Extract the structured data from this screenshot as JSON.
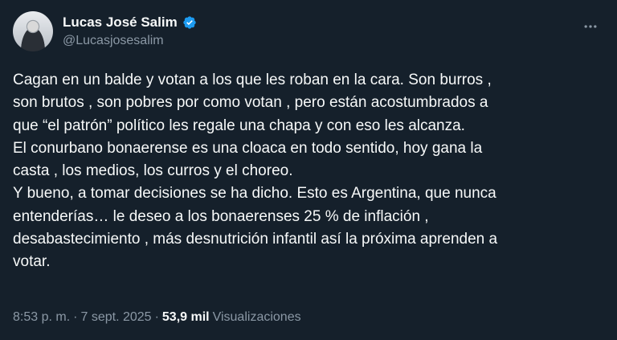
{
  "author": {
    "display_name": "Lucas José Salim",
    "handle": "@Lucasjosesalim",
    "verified": true,
    "avatar_icon": "profile-photo"
  },
  "more_icon": "more-horizontal-icon",
  "tweet": {
    "text": "Cagan en un balde y votan a los que les roban en la cara. Son burros ,\nson brutos , son pobres por como votan , pero están acostumbrados a\nque “el patrón” político les regale una chapa y con eso les alcanza.\nEl conurbano bonaerense es una cloaca en todo sentido, hoy gana la\ncasta , los medios, los curros y el choreo.\nY bueno, a tomar decisiones se ha dicho. Esto es Argentina, que nunca\nentenderías… le deseo a los bonaerenses 25 % de inflación ,\ndesabastecimiento , más desnutrición infantil así la próxima aprenden a\nvotar."
  },
  "meta": {
    "time": "8:53 p. m.",
    "separator1": "·",
    "date": "7 sept. 2025",
    "separator2": "·",
    "views_count": "53,9 mil",
    "views_label": "Visualizaciones"
  },
  "colors": {
    "background": "#15202b",
    "text": "#f7f9f9",
    "secondary": "#8b98a5",
    "verified": "#1d9bf0"
  }
}
